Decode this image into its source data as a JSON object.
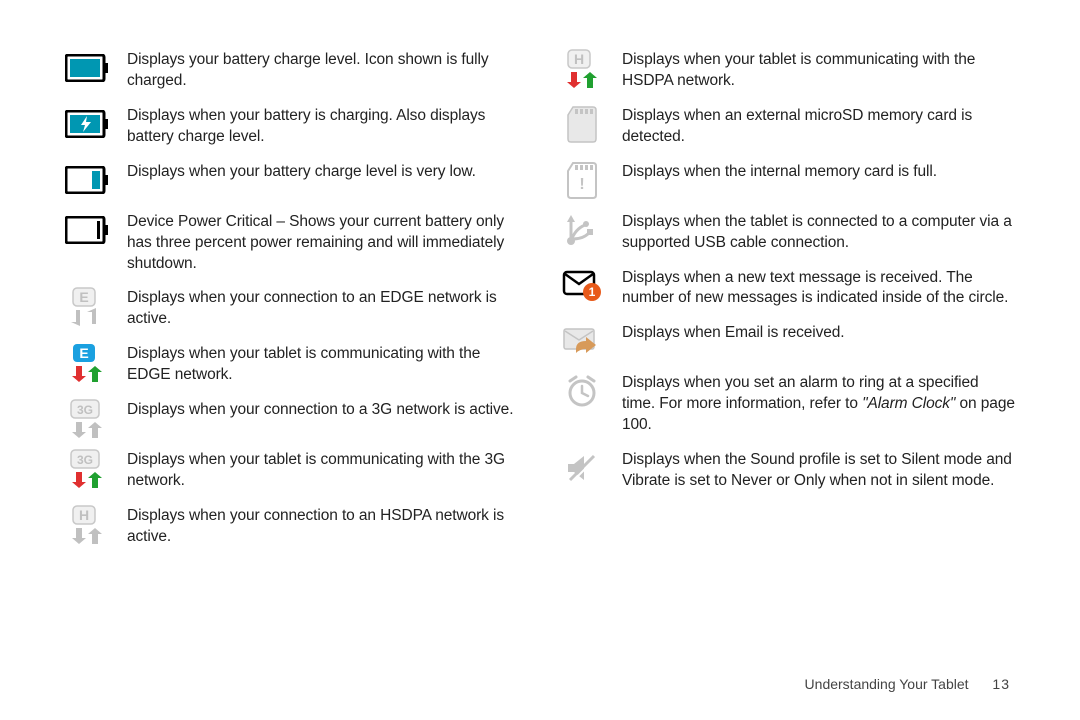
{
  "footer": {
    "section": "Understanding Your Tablet",
    "page": "13"
  },
  "left": [
    {
      "icon": "battery-full-icon",
      "text": "Displays your battery charge level. Icon shown is fully charged."
    },
    {
      "icon": "battery-charging-icon",
      "text": "Displays when your battery is charging. Also displays battery charge level."
    },
    {
      "icon": "battery-low-icon",
      "text": "Displays when your battery charge level is very low."
    },
    {
      "icon": "battery-critical-icon",
      "text": "Device Power Critical – Shows your current battery only has three percent power remaining and will immediately shutdown."
    },
    {
      "icon": "edge-idle-icon",
      "text": "Displays when your connection to an EDGE network is active."
    },
    {
      "icon": "edge-active-icon",
      "text": "Displays when your tablet is communicating with the EDGE network."
    },
    {
      "icon": "threeg-idle-icon",
      "text": "Displays when your connection to a 3G network is active."
    },
    {
      "icon": "threeg-active-icon",
      "text": "Displays when your tablet is communicating with the 3G network."
    },
    {
      "icon": "hsdpa-idle-icon",
      "text": "Displays when your connection to an HSDPA network is active."
    }
  ],
  "right": [
    {
      "icon": "hsdpa-active-icon",
      "text": "Displays when your tablet is communicating with the HSDPA network."
    },
    {
      "icon": "sd-detected-icon",
      "text": "Displays when an external microSD memory card is detected."
    },
    {
      "icon": "sd-full-icon",
      "text": "Displays when the internal memory card is full."
    },
    {
      "icon": "usb-icon",
      "text": "Displays when the tablet is connected to a computer via a supported USB cable connection."
    },
    {
      "icon": "sms-icon",
      "text": "Displays when a new text message is received. The number of new messages is indicated inside of the circle."
    },
    {
      "icon": "email-icon",
      "text": "Displays when Email is received."
    },
    {
      "icon": "alarm-icon",
      "text_pre": "Displays when you set an alarm to ring at a specified time. For more information, refer to ",
      "text_italic": "\"Alarm Clock\" ",
      "text_post": " on page 100."
    },
    {
      "icon": "silent-icon",
      "text": "Displays when the Sound profile is set to Silent mode and Vibrate is set to Never or Only when not in silent mode."
    }
  ]
}
